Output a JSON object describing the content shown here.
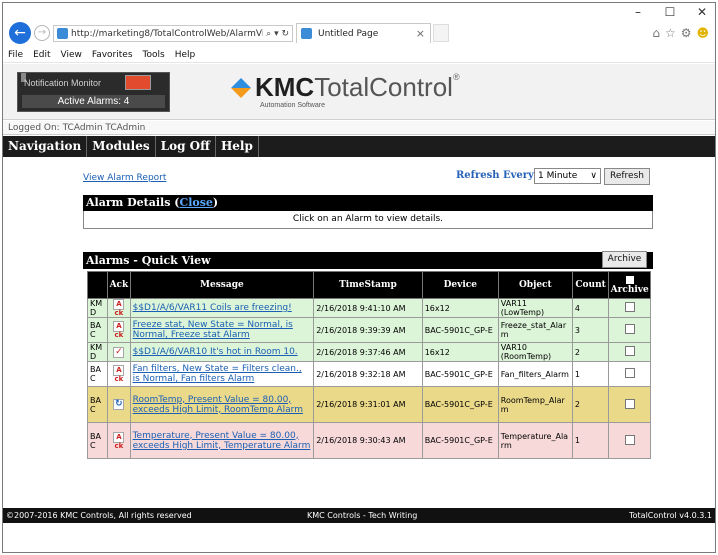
{
  "browser": {
    "window_controls": {
      "minimize": "–",
      "maximize": "☐",
      "close": "✕"
    },
    "back_glyph": "←",
    "forward_glyph": "→",
    "address": "http://marketing8/TotalControlWeb/AlarmVie",
    "address_controls": "⌕ ▾ ↻",
    "tab_title": "Untitled Page",
    "tab_close": "×",
    "toolbar_icons": [
      "⌂",
      "☆",
      "⚙",
      "☻"
    ],
    "menu": [
      "File",
      "Edit",
      "View",
      "Favorites",
      "Tools",
      "Help"
    ]
  },
  "header": {
    "notification_title": "Notification Monitor",
    "active_alarms": "Active Alarms: 4",
    "brand_bold": "KMC",
    "brand_light": "TotalControl",
    "brand_reg": "®",
    "tagline": "Automation Software",
    "logged_on": "Logged On: TCAdmin TCAdmin"
  },
  "nav": [
    "Navigation",
    "Modules",
    "Log Off",
    "Help"
  ],
  "content": {
    "view_report": "View Alarm Report",
    "refresh_label": "Refresh Every:",
    "refresh_value": "1 Minute",
    "refresh_button": "Refresh",
    "details_title": "Alarm Details (",
    "details_close": "Close",
    "details_title_end": ")",
    "details_text": "Click on an Alarm to view details.",
    "quickview_title": "Alarms - Quick View",
    "archive_button": "Archive"
  },
  "table": {
    "headers": [
      "",
      "Ack",
      "Message",
      "TimeStamp",
      "Device",
      "Object",
      "Count",
      "Archive"
    ],
    "rows": [
      {
        "src": "KMD",
        "ack": "Ack",
        "message": "$$D1/A/6/VAR11 Coils are freezing!",
        "timestamp": "2/16/2018 9:41:10 AM",
        "device": "16x12",
        "object": "VAR11 (LowTemp)",
        "count": "4",
        "color": "green"
      },
      {
        "src": "BAC",
        "ack": "Ack",
        "message": "Freeze stat, New State = Normal, is Normal, Freeze stat Alarm",
        "timestamp": "2/16/2018 9:39:39 AM",
        "device": "BAC-5901C_GP-E",
        "object": "Freeze_stat_Alarm",
        "count": "3",
        "color": "green"
      },
      {
        "src": "KMD",
        "ack": "✓",
        "message": "$$D1/A/6/VAR10 It's hot in Room 10.",
        "timestamp": "2/16/2018 9:37:46 AM",
        "device": "16x12",
        "object": "VAR10 (RoomTemp)",
        "count": "2",
        "color": "green"
      },
      {
        "src": "BAC",
        "ack": "Ack",
        "message": "Fan filters, New State = Filters clean., is Normal, Fan filters Alarm",
        "timestamp": "2/16/2018 9:32:18 AM",
        "device": "BAC-5901C_GP-E",
        "object": "Fan_filters_Alarm",
        "count": "1",
        "color": "white"
      },
      {
        "src": "BAC",
        "ack": "↻",
        "message": "RoomTemp, Present Value = 80.00, exceeds High Limit, RoomTemp Alarm",
        "timestamp": "2/16/2018 9:31:01 AM",
        "device": "BAC-5901C_GP-E",
        "object": "RoomTemp_Alarm",
        "count": "2",
        "color": "yellow"
      },
      {
        "src": "BAC",
        "ack": "Ack",
        "message": "Temperature, Present Value = 80.00, exceeds High Limit, Temperature Alarm",
        "timestamp": "2/16/2018 9:30:43 AM",
        "device": "BAC-5901C_GP-E",
        "object": "Temperature_Alarm",
        "count": "1",
        "color": "pink"
      }
    ]
  },
  "footer": {
    "copyright": "©2007-2016 KMC Controls, All rights reserved",
    "center": "KMC Controls - Tech Writing",
    "version": "TotalControl v4.0.3.1"
  }
}
